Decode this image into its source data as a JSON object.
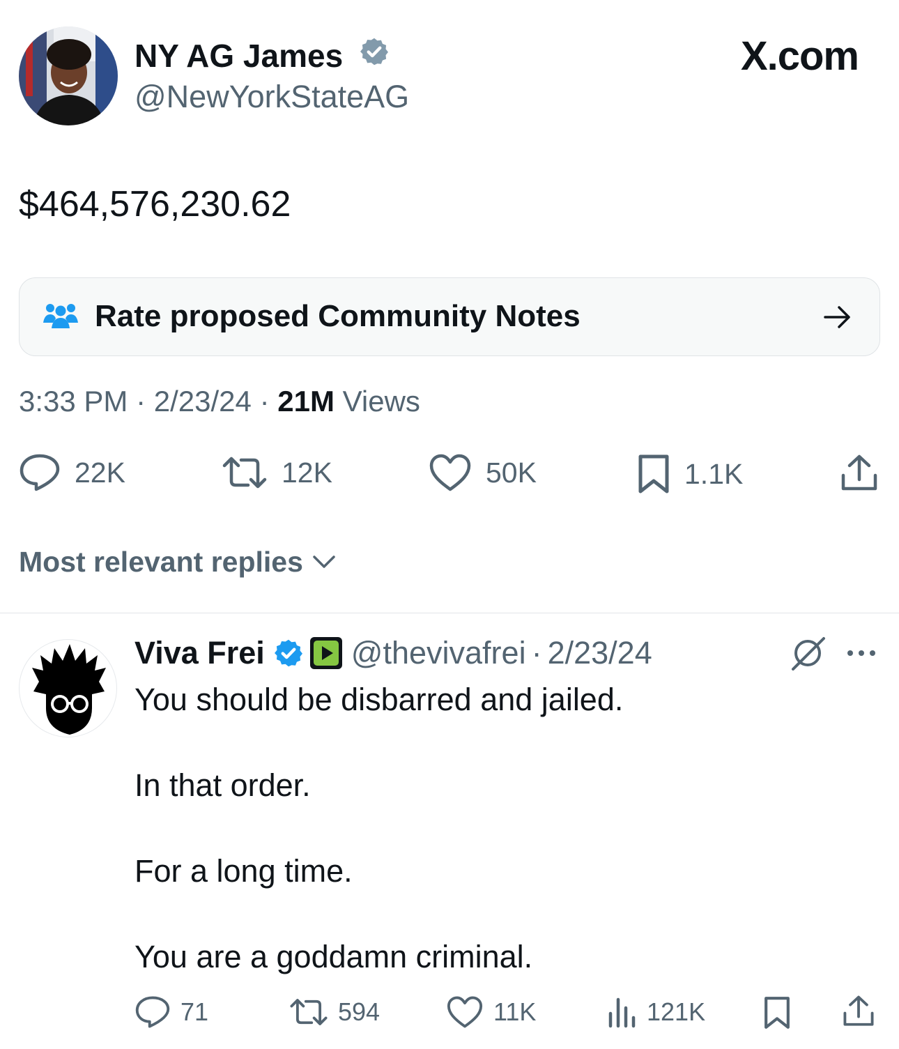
{
  "tweet": {
    "author_name": "NY AG James",
    "author_handle": "@NewYorkStateAG",
    "brand": "X.com",
    "text": "$464,576,230.62",
    "community_notes_label": "Rate proposed Community Notes",
    "time": "3:33 PM",
    "date": "2/23/24",
    "views_count": "21M",
    "views_label": "Views",
    "separator": "·",
    "actions": {
      "replies": "22K",
      "reposts": "12K",
      "likes": "50K",
      "bookmarks": "1.1K"
    }
  },
  "replies_sort_label": "Most relevant replies",
  "reply": {
    "author_name": "Viva Frei",
    "author_handle": "@thevivafrei",
    "separator": "·",
    "date": "2/23/24",
    "lines": [
      "You should be disbarred and jailed.",
      "In that order.",
      "For a long time.",
      "You are a goddamn criminal."
    ],
    "actions": {
      "replies": "71",
      "reposts": "594",
      "likes": "11K",
      "views": "121K"
    }
  },
  "colors": {
    "verified_blue": "#1d9bf0",
    "verified_gray": "#829aab",
    "muted_text": "#536471",
    "rumble_green": "#85c742"
  }
}
